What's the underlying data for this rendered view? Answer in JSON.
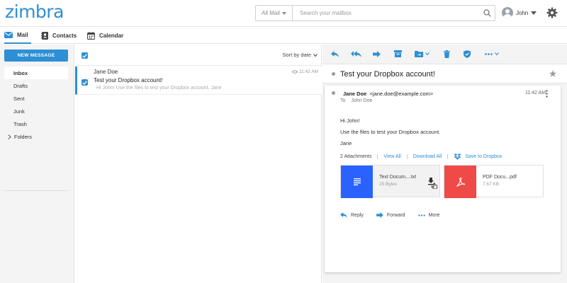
{
  "brand": {
    "logo": "zimbra",
    "accent": "#2d8fd5"
  },
  "header": {
    "search_scope": "All Mail",
    "search_placeholder": "Search your mailbox",
    "user_name": "John"
  },
  "apptabs": [
    {
      "label": "Mail",
      "icon": "mail-icon",
      "active": true
    },
    {
      "label": "Contacts",
      "icon": "contacts-icon"
    },
    {
      "label": "Calendar",
      "icon": "calendar-icon"
    }
  ],
  "sidebar": {
    "new_message": "NEW MESSAGE",
    "folders": [
      {
        "label": "Inbox",
        "active": true
      },
      {
        "label": "Drafts"
      },
      {
        "label": "Sent"
      },
      {
        "label": "Junk"
      },
      {
        "label": "Trash"
      },
      {
        "label": "Folders",
        "expandable": true
      }
    ]
  },
  "list": {
    "sort_label": "Sort by date",
    "messages": [
      {
        "from": "Jane Doe",
        "subject": "Test your Dropbox account!",
        "snippet": "Hi John!   Use the files to test your Dropbox account.   Jane",
        "time": "11:42 AM"
      }
    ]
  },
  "reading": {
    "subject": "Test your Dropbox account!",
    "from_name": "Jane Doe",
    "from_email": "<jane.doe@example.com>",
    "to_label": "To",
    "to_name": "John Doe",
    "time": "11:42 AM",
    "body": [
      "Hi John!",
      "Use the files to test your Dropbox account.",
      "Jane"
    ],
    "attachments_count": "2 Attachments",
    "view_all": "View All",
    "download_all": "Download All",
    "save_dropbox": "Save to Dropbox",
    "attachments": [
      {
        "name": "Text Docum....txt",
        "size": "25 Bytes",
        "thumb_color": "#2962ff",
        "icon": "document-icon"
      },
      {
        "name": "PDF Docu...pdf",
        "size": "7.67 KB",
        "thumb_color": "#ef4a47",
        "icon": "pdf-icon"
      }
    ],
    "actions": {
      "reply": "Reply",
      "forward": "Forward",
      "more": "More"
    }
  }
}
